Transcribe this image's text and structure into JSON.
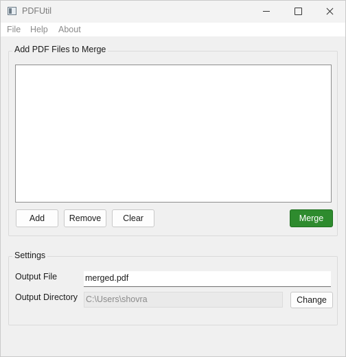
{
  "window": {
    "title": "PDFUtil",
    "icons": {
      "app": "pdf-app-icon",
      "minimize": "minimize-icon",
      "maximize": "maximize-icon",
      "close": "close-icon"
    }
  },
  "menu": {
    "items": [
      {
        "label": "File"
      },
      {
        "label": "Help"
      },
      {
        "label": "About"
      }
    ]
  },
  "merge_group": {
    "title": "Add PDF Files to Merge",
    "files": [],
    "buttons": {
      "add": "Add",
      "remove": "Remove",
      "clear": "Clear",
      "merge": "Merge"
    },
    "merge_color": "#2e8b2e"
  },
  "settings": {
    "title": "Settings",
    "output_file_label": "Output File",
    "output_file_value": "merged.pdf",
    "output_dir_label": "Output Directory",
    "output_dir_value": "C:\\Users\\shovra",
    "change_label": "Change"
  }
}
